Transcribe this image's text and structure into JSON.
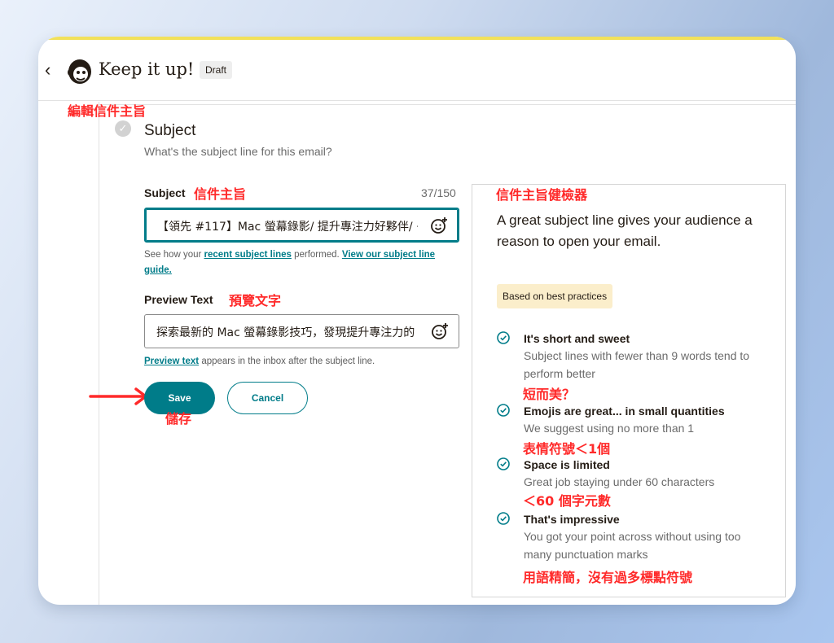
{
  "header": {
    "back_icon": "chevron-left-icon",
    "logo_icon": "mailchimp-logo-icon",
    "title": "Keep it up!",
    "badge": "Draft"
  },
  "annotations": {
    "edit_subject": "編輯信件主旨",
    "subject": "信件主旨",
    "checker": "信件主旨健檢器",
    "preview": "預覽文字",
    "save": "儲存",
    "short_sweet": "短而美？",
    "emoji": "表情符號＜1個",
    "space": "＜60 個字元數",
    "impressive": "用語精簡，沒有過多標點符號"
  },
  "section": {
    "title": "Subject",
    "subtitle": "What's the subject line for this email?"
  },
  "subject_field": {
    "label": "Subject",
    "count": "37/150",
    "value": "【領先 #117】Mac 螢幕錄影/ 提升專注力好夥伴/ ·",
    "emoji_icon": "emoji-add-icon",
    "help_prefix": "See how your ",
    "help_link1": "recent subject lines",
    "help_mid": " performed. ",
    "help_link2": "View our subject line guide."
  },
  "preview_field": {
    "label": "Preview Text",
    "value": "探索最新的 Mac 螢幕錄影技巧，發現提升專注力的",
    "emoji_icon": "emoji-add-icon",
    "help_link": "Preview text",
    "help_suffix": " appears in the inbox after the subject line."
  },
  "actions": {
    "save": "Save",
    "cancel": "Cancel"
  },
  "panel": {
    "headline": "A great subject line gives your audience a reason to open your email.",
    "badge": "Based on best practices",
    "tips": [
      {
        "title": "It's short and sweet",
        "desc": "Subject lines with fewer than 9 words tend to perform better"
      },
      {
        "title": "Emojis are great... in small quantities",
        "desc": "We suggest using no more than 1"
      },
      {
        "title": "Space is limited",
        "desc": "Great job staying under 60 characters"
      },
      {
        "title": "That's impressive",
        "desc": "You got your point across without using too many punctuation marks"
      }
    ]
  },
  "colors": {
    "accent": "#007c89",
    "annotation": "#ff2a2a",
    "badge_bg": "#fbeecb",
    "top_line": "#f2e15a"
  }
}
